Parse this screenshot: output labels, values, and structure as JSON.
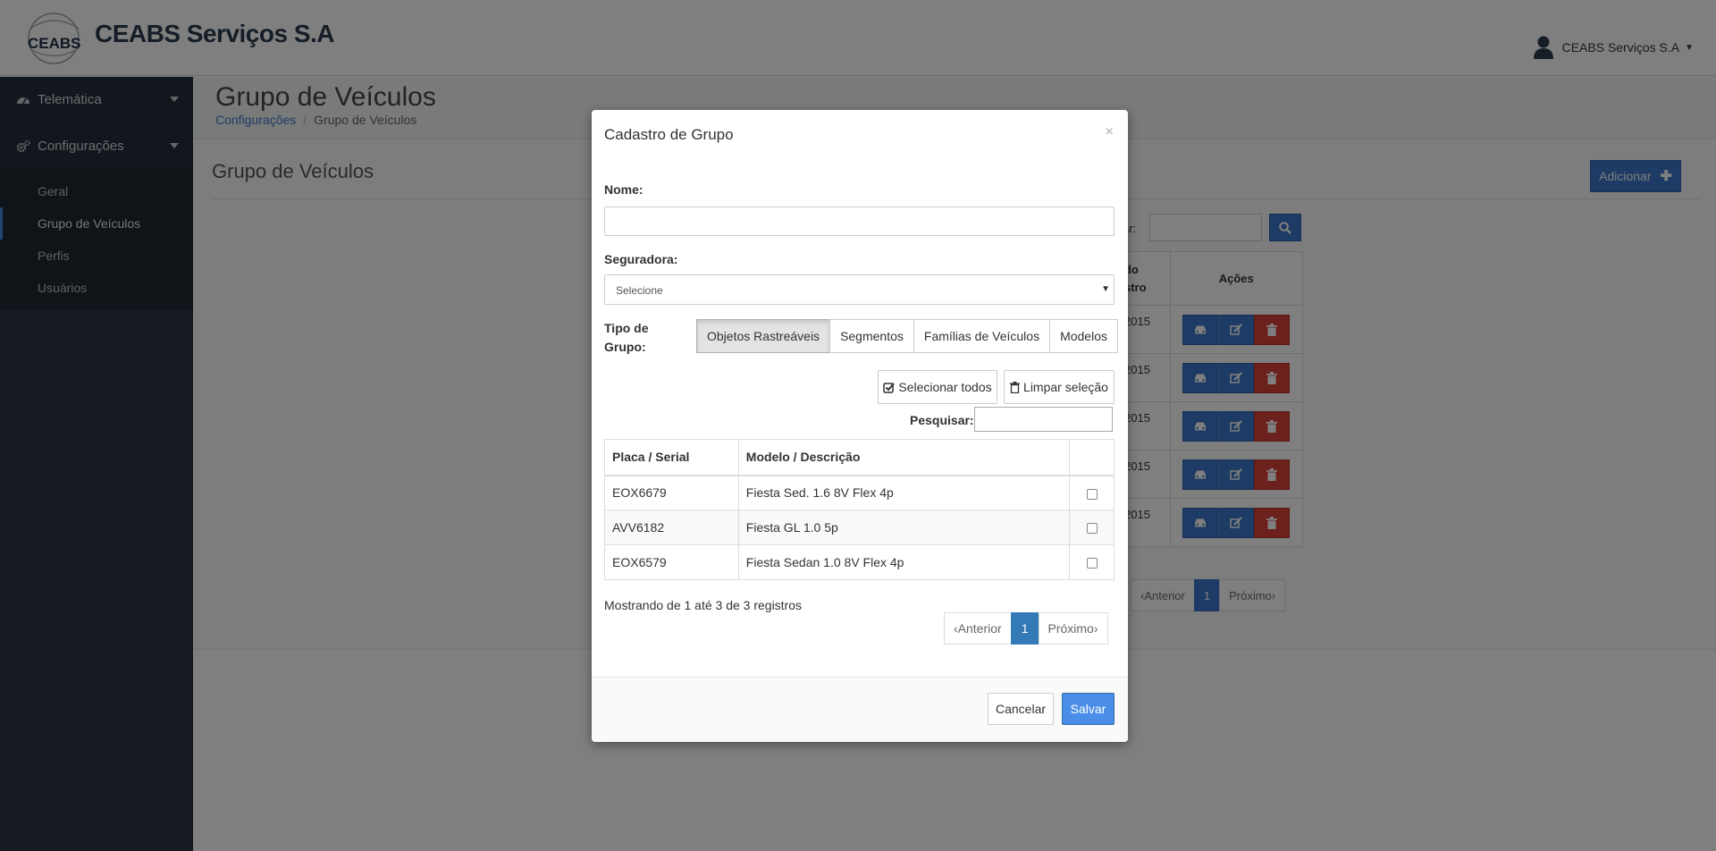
{
  "header": {
    "brand": "CEABS Serviços S.A",
    "logo_text": "CEABS",
    "user_name": "CEABS Serviços S.A"
  },
  "sidebar": {
    "sections": [
      {
        "label": "Telemática",
        "icon": "dashboard-icon"
      },
      {
        "label": "Configurações",
        "icon": "cogs-icon"
      }
    ],
    "items": [
      {
        "label": "Geral"
      },
      {
        "label": "Grupo de Veículos"
      },
      {
        "label": "Perfis"
      },
      {
        "label": "Usuários"
      }
    ]
  },
  "page": {
    "title": "Grupo de Veículos",
    "breadcrumb": [
      {
        "label": "Configurações"
      },
      {
        "label": "Grupo de Veículos"
      }
    ],
    "panel_title": "Grupo de Veículos",
    "add_button": "Adicionar",
    "search_label_partial": "ar:",
    "table_header_partial": [
      "do",
      "stro"
    ],
    "actions_header": "Ações",
    "rows_partial": [
      "2015",
      "2015",
      "2015",
      "2015",
      "2015"
    ],
    "pager": {
      "prev": "Anterior",
      "current": "1",
      "next": "Próximo"
    }
  },
  "modal": {
    "title": "Cadastro de Grupo",
    "close": "×",
    "name_label": "Nome:",
    "name_value": "",
    "insurer_label": "Seguradora:",
    "insurer_selected": "Selecione",
    "group_type_label_1": "Tipo de",
    "group_type_label_2": "Grupo:",
    "group_types": [
      {
        "label": "Objetos Rastreáveis"
      },
      {
        "label": "Segmentos"
      },
      {
        "label": "Famílias de Veículos"
      },
      {
        "label": "Modelos"
      }
    ],
    "select_all": "Selecionar todos",
    "clear_selection": "Limpar seleção",
    "search_label": "Pesquisar:",
    "search_value": "",
    "table": {
      "headers": [
        "Placa / Serial",
        "Modelo / Descrição",
        ""
      ],
      "rows": [
        {
          "plate": "EOX6679",
          "model": "Fiesta Sed. 1.6 8V Flex 4p"
        },
        {
          "plate": "AVV6182",
          "model": "Fiesta GL 1.0 5p"
        },
        {
          "plate": "EOX6579",
          "model": "Fiesta Sedan 1.0 8V Flex 4p"
        }
      ]
    },
    "info": "Mostrando de 1 até 3 de 3 registros",
    "pager": {
      "prev": "Anterior",
      "current": "1",
      "next": "Próximo"
    },
    "cancel": "Cancelar",
    "save": "Salvar"
  }
}
